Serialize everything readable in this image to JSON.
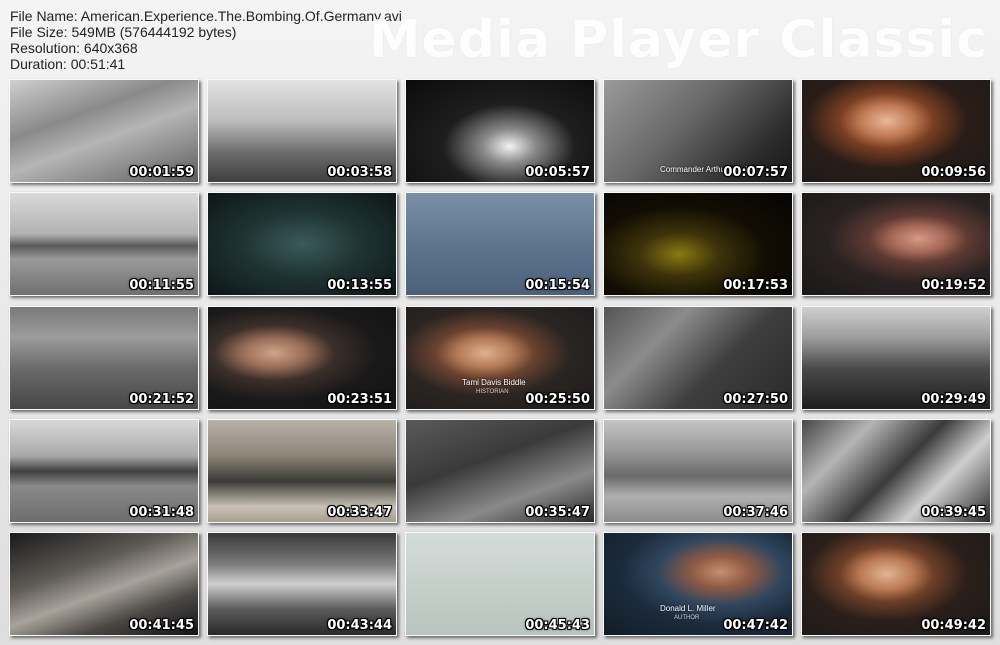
{
  "info": {
    "file_name": "File Name: American.Experience.The.Bombing.Of.Germany.avi",
    "file_size": "File Size: 549MB (576444192 bytes)",
    "resolution": "Resolution: 640x368",
    "duration": "Duration: 00:51:41"
  },
  "watermark": "Media Player Classic",
  "thumbnails": [
    {
      "time": "00:01:59",
      "bg": "linear-gradient(160deg,#cfcfcf 0%,#8a8a8a 35%,#b5b5b5 55%,#5d5d5d 100%)"
    },
    {
      "time": "00:03:58",
      "bg": "linear-gradient(180deg,#e2e2e2 0%,#bdbdbd 40%,#6e6e6e 70%,#3f3f3f 100%)"
    },
    {
      "time": "00:05:57",
      "bg": "radial-gradient(ellipse at 55% 65%,#f3f3f3 0%,#8a8a8a 18%,#1e1e1e 45%,#0b0b0b 100%)"
    },
    {
      "time": "00:07:57",
      "bg": "linear-gradient(135deg,#9a9a9a 0%,#6b6b6b 40%,#2a2a2a 80%,#1a1a1a 100%)",
      "caption": "Commander Arthur Harris"
    },
    {
      "time": "00:09:56",
      "bg": "radial-gradient(ellipse at 45% 40%,#e8b89a 0%,#c07a55 18%,#7a3f22 32%,#2a1d18 55%,#1a1a1a 100%)"
    },
    {
      "time": "00:11:55",
      "bg": "linear-gradient(180deg,#d9d9d9 0%,#b2b2b2 40%,#5a5a5a 52%,#9a9a9a 65%,#707070 100%)"
    },
    {
      "time": "00:13:55",
      "bg": "radial-gradient(ellipse at 50% 50%,#3b5a5a 0%,#1f3333 45%,#0d1616 100%)"
    },
    {
      "time": "00:15:54",
      "bg": "linear-gradient(180deg,#7c8fa6 0%,#5e7590 50%,#4c6079 100%)"
    },
    {
      "time": "00:17:53",
      "bg": "radial-gradient(ellipse at 40% 60%,#8a7a10 0%,#3d330a 25%,#120d04 55%,#050404 100%)"
    },
    {
      "time": "00:19:52",
      "bg": "radial-gradient(ellipse at 62% 45%,#d49a86 0%,#a96a58 16%,#5e3a33 30%,#2a2222 55%,#1a1818 100%)"
    },
    {
      "time": "00:21:52",
      "bg": "linear-gradient(180deg,#7a7a7a 0%,#9c9c9c 30%,#6a6a6a 60%,#474747 100%)"
    },
    {
      "time": "00:23:51",
      "bg": "radial-gradient(ellipse at 35% 45%,#d0a48a 0%,#9a6e58 18%,#3b2f2a 35%,#1a1919 60%,#121212 100%)"
    },
    {
      "time": "00:25:50",
      "bg": "radial-gradient(ellipse at 42% 45%,#e0b090 0%,#b37a56 18%,#6a4230 32%,#2a2522 55%,#1c1c1c 100%)",
      "caption": "Tami Davis Biddle",
      "caption2": "HISTORIAN"
    },
    {
      "time": "00:27:50",
      "bg": "linear-gradient(135deg,#545454 0%,#8c8c8c 30%,#3e3e3e 60%,#2a2a2a 100%)"
    },
    {
      "time": "00:29:49",
      "bg": "linear-gradient(180deg,#cfcfcf 0%,#9d9d9d 30%,#4a4a4a 60%,#1e1e1e 100%)"
    },
    {
      "time": "00:31:48",
      "bg": "linear-gradient(180deg,#d8d8d8 0%,#a9a9a9 35%,#404040 50%,#8a8a8a 65%,#6d6d6d 100%)"
    },
    {
      "time": "00:33:47",
      "bg": "linear-gradient(180deg,#b9b2a6 0%,#8c8578 35%,#3b3a36 60%,#c9c2b5 85%,#a59d90 100%)"
    },
    {
      "time": "00:35:47",
      "bg": "linear-gradient(160deg,#5a5a5a 0%,#3a3a3a 40%,#8a8a8a 70%,#2a2a2a 100%)"
    },
    {
      "time": "00:37:46",
      "bg": "linear-gradient(180deg,#c4c4c4 0%,#9a9a9a 30%,#6a6a6a 55%,#b0b0b0 75%,#8a8a8a 100%)"
    },
    {
      "time": "00:39:45",
      "bg": "linear-gradient(135deg,#474747 0%,#b5b5b5 25%,#3a3a3a 50%,#cfcfcf 70%,#2a2a2a 100%)"
    },
    {
      "time": "00:41:45",
      "bg": "linear-gradient(160deg,#1a1a1a 0%,#5e5a55 35%,#a8a49c 55%,#4a4744 75%,#151515 100%)"
    },
    {
      "time": "00:43:44",
      "bg": "linear-gradient(180deg,#3a3a3a 0%,#7a7a7a 30%,#cfcfcf 50%,#5a5a5a 75%,#2a2a2a 100%)"
    },
    {
      "time": "00:45:43",
      "bg": "linear-gradient(180deg,#d4dcd8 0%,#c6d0cb 50%,#b9c4be 100%)"
    },
    {
      "time": "00:47:42",
      "bg": "radial-gradient(ellipse at 62% 38%,#c78d70 0%,#8e5a44 18%,#30465e 38%,#1b2b3c 60%,#121c26 100%)",
      "caption": "Donald L. Miller",
      "caption2": "AUTHOR"
    },
    {
      "time": "00:49:42",
      "bg": "radial-gradient(ellipse at 45% 40%,#e2b494 0%,#bb7a55 18%,#6e3f28 32%,#2a1f1a 55%,#1a1a1a 100%)"
    }
  ]
}
